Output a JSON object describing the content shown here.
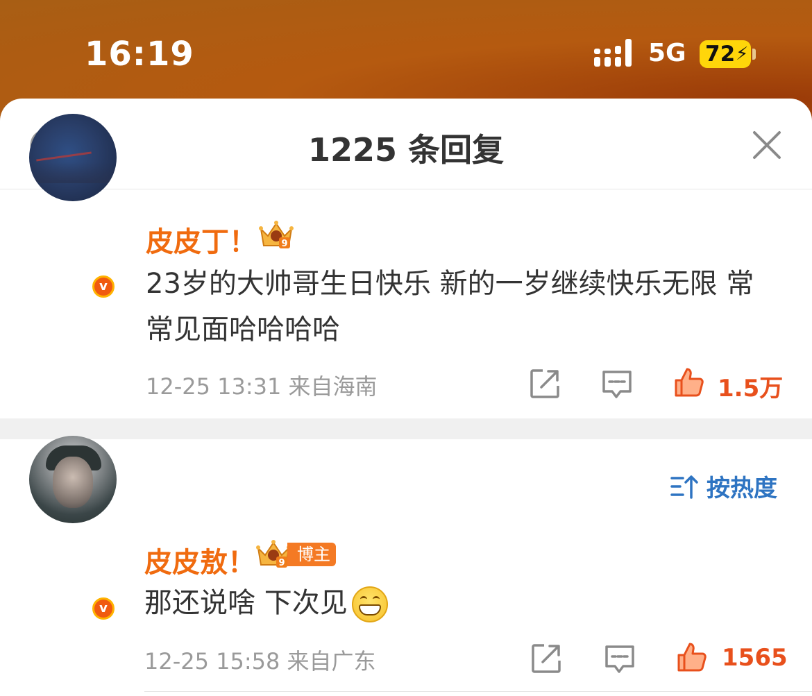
{
  "status_bar": {
    "time": "16:19",
    "network": "5G",
    "battery": "72",
    "battery_charging": true
  },
  "sheet": {
    "title": "1225 条回复",
    "refresh_icon": "refresh-icon",
    "close_icon": "close-icon"
  },
  "main_comment": {
    "username": "皮皮丁！",
    "content": "23岁的大帅哥生日快乐 新的一岁继续快乐无限 常常见面哈哈哈哈",
    "timestamp": "12-25 13:31",
    "location": "来自海南",
    "likes": "1.5万",
    "verified": true
  },
  "sort": {
    "label": "按热度"
  },
  "reply": {
    "username": "皮皮敖！",
    "tag": "博主",
    "content": "那还说啥 下次见",
    "emoji": "grin-emoji",
    "timestamp": "12-25 15:58",
    "location": "来自广东",
    "likes": "1565",
    "verified": true
  },
  "colors": {
    "accent_orange": "#f06b0f",
    "like_red": "#e8501c",
    "sort_blue": "#2e74c2",
    "meta_gray": "#9a9a9a"
  }
}
